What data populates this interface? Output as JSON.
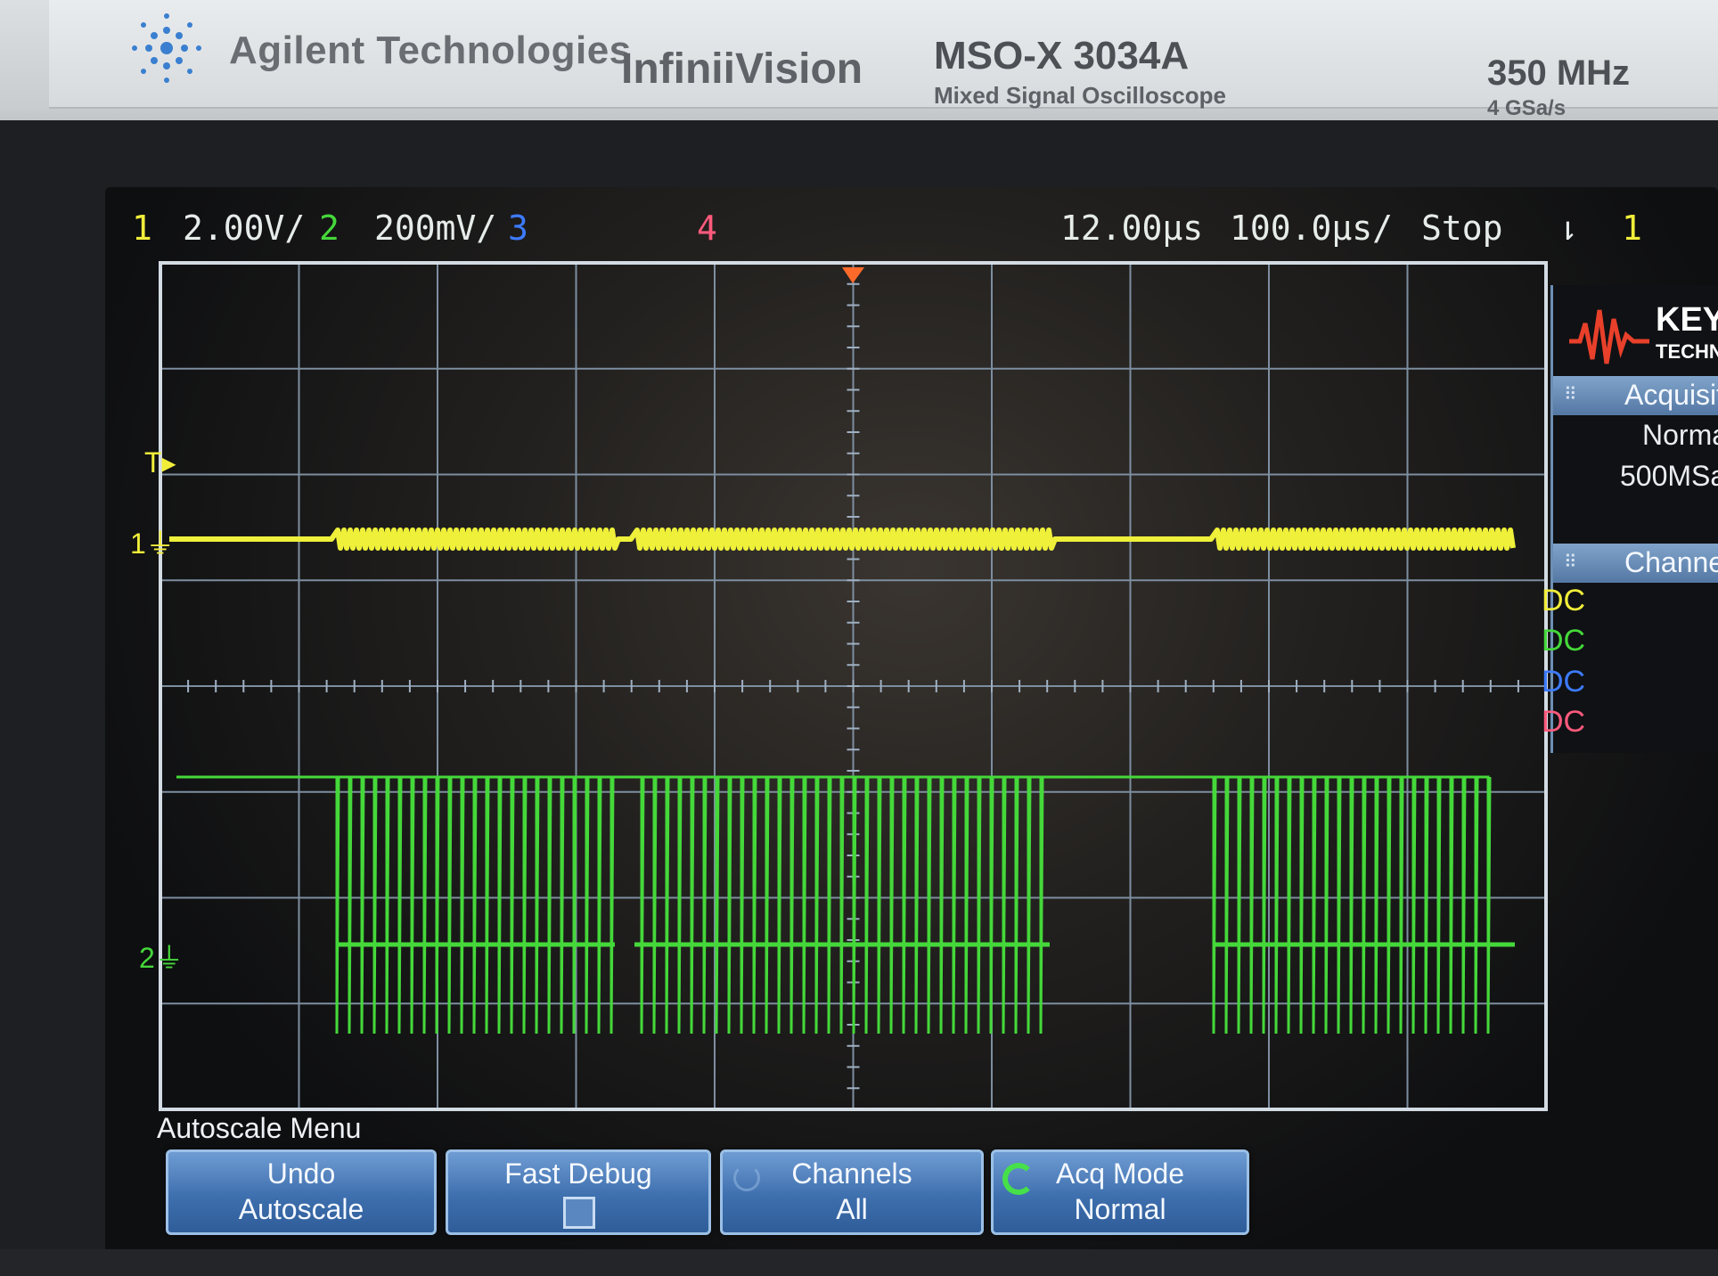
{
  "brand": {
    "name": "Agilent Technologies",
    "series": "InfiniiVision",
    "model": "MSO-X 3034A",
    "model_sub": "Mixed Signal Oscilloscope",
    "bandwidth": "350 MHz",
    "sample_rate": "4 GSa/s",
    "edge_cut": "M"
  },
  "status": {
    "ch1_num": "1",
    "ch1_scale": "2.00V/",
    "ch2_num": "2",
    "ch2_scale": "200mV/",
    "ch3_num": "3",
    "ch4_num": "4",
    "time_delay": "12.00µs",
    "time_base": "100.0µs/",
    "run_state": "Stop",
    "trigger_source": "1"
  },
  "markers": {
    "trigger_marker": "T",
    "ch1_marker": "1",
    "ch2_marker": "2"
  },
  "side_panel": {
    "logo_text": "KEY",
    "logo_sub": "TECHN",
    "acq_header": "Acquisit",
    "acq_mode": "Norma",
    "acq_rate": "500MSa",
    "channels_header": "Channel",
    "coupling": [
      "DC",
      "DC",
      "DC",
      "DC"
    ]
  },
  "softkeys": {
    "menu_title": "Autoscale Menu",
    "undo_l1": "Undo",
    "undo_l2": "Autoscale",
    "fast_debug": "Fast Debug",
    "channels_l1": "Channels",
    "channels_l2": "All",
    "acq_l1": "Acq Mode",
    "acq_l2": "Normal"
  },
  "colors": {
    "ch1": "#f1ee3a",
    "ch2": "#45d83a",
    "ch3": "#3d7bff",
    "ch4": "#ff5a7c",
    "softkey": "#3e6fae"
  }
}
